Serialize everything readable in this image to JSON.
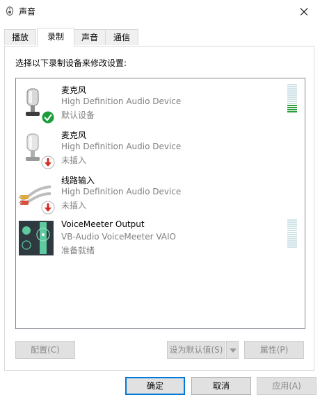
{
  "window": {
    "title": "声音"
  },
  "tabs": [
    {
      "label": "播放"
    },
    {
      "label": "录制"
    },
    {
      "label": "声音"
    },
    {
      "label": "通信"
    }
  ],
  "instruction": "选择以下录制设备来修改设置:",
  "devices": [
    {
      "name": "麦克风",
      "description": "High Definition Audio Device",
      "status": "默认设备",
      "status_icon": "check-badge",
      "level_fraction": 0.25
    },
    {
      "name": "麦克风",
      "description": "High Definition Audio Device",
      "status": "未插入",
      "status_icon": "unplugged-badge"
    },
    {
      "name": "线路输入",
      "description": "High Definition Audio Device",
      "status": "未插入",
      "status_icon": "unplugged-badge"
    },
    {
      "name": "VoiceMeeter Output",
      "description": "VB-Audio VoiceMeeter VAIO",
      "status": "准备就绪",
      "level_fraction": 0
    }
  ],
  "panel_buttons": {
    "configure": "配置(C)",
    "set_default": "设为默认值(S)",
    "properties": "属性(P)"
  },
  "dialog_buttons": {
    "ok": "确定",
    "cancel": "取消",
    "apply": "应用(A)"
  },
  "colors": {
    "accent": "#0078d7",
    "meter_lit": "#2b9f3c",
    "check_green": "#1a9e3a",
    "unplugged_red": "#d42a1f"
  }
}
